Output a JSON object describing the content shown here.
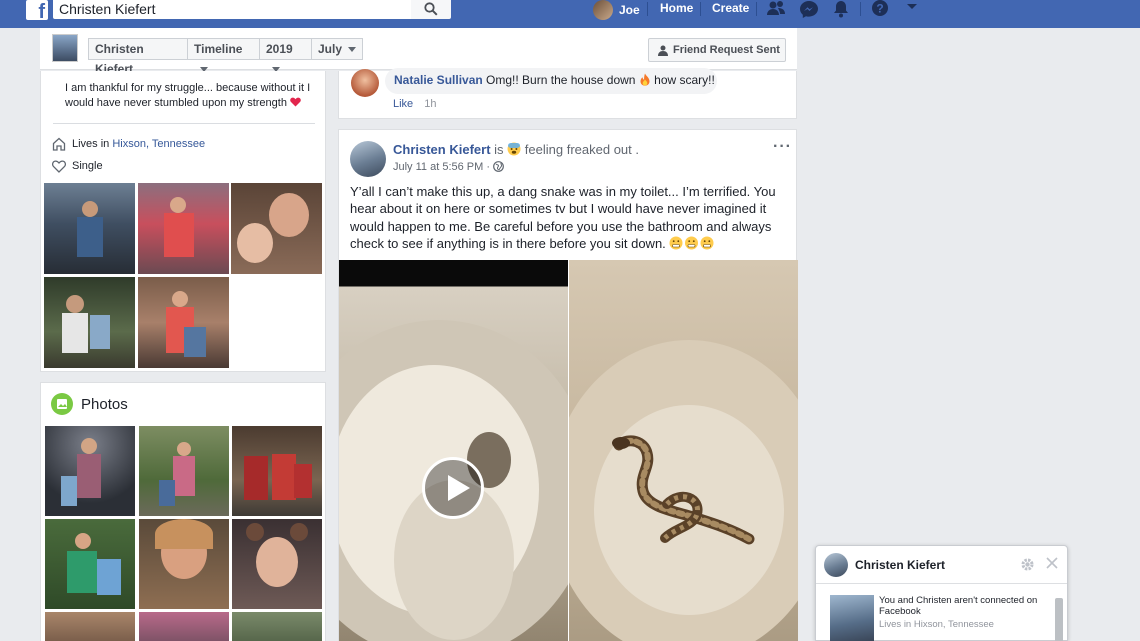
{
  "topbar": {
    "logo": "f",
    "search_value": "Christen Kiefert",
    "user_name": "Joe",
    "home_label": "Home",
    "create_label": "Create"
  },
  "subheader": {
    "crumbs": [
      "Christen Kiefert",
      "Timeline",
      "2019",
      "July"
    ],
    "friend_button": "Friend Request Sent"
  },
  "intro": {
    "quote": "I am thankful for my struggle... because without it I would have never stumbled upon my strength",
    "lives_prefix": "Lives in",
    "lives_place": "Hixson, Tennessee",
    "relationship": "Single"
  },
  "photos": {
    "title": "Photos"
  },
  "comment": {
    "author": "Natalie Sullivan",
    "text": "Omg!! Burn the house down",
    "text_end": "how scary!!",
    "like_label": "Like",
    "time": "1h"
  },
  "post": {
    "author": "Christen Kiefert",
    "verb": "is",
    "feeling": "feeling freaked out .",
    "date": "July 11 at 5:56 PM ·",
    "text": "Y’all I can’t make this up, a dang snake was in my toilet... I’m terrified. You hear about it on here or sometimes tv but I would have never imagined it would happen to me. Be careful before you use the bathroom and always check to see if anything is in there before you sit down.",
    "more_label": "···"
  },
  "chat": {
    "name": "Christen Kiefert",
    "line1": "You and Christen aren't connected on Facebook",
    "line2": "Lives in Hixson, Tennessee"
  },
  "icons": {
    "search": "search-icon",
    "friends": "friends-icon",
    "messenger": "messenger-icon",
    "notifications": "bell-icon",
    "help": "help-icon",
    "menu": "caret-down-icon",
    "home_location": "house-icon",
    "relationship": "heart-icon",
    "globe": "globe-icon",
    "play": "play-icon",
    "gear": "gear-icon",
    "close": "close-icon"
  },
  "colors": {
    "brand": "#4267b2",
    "link": "#385898",
    "background": "#e9ebee"
  }
}
